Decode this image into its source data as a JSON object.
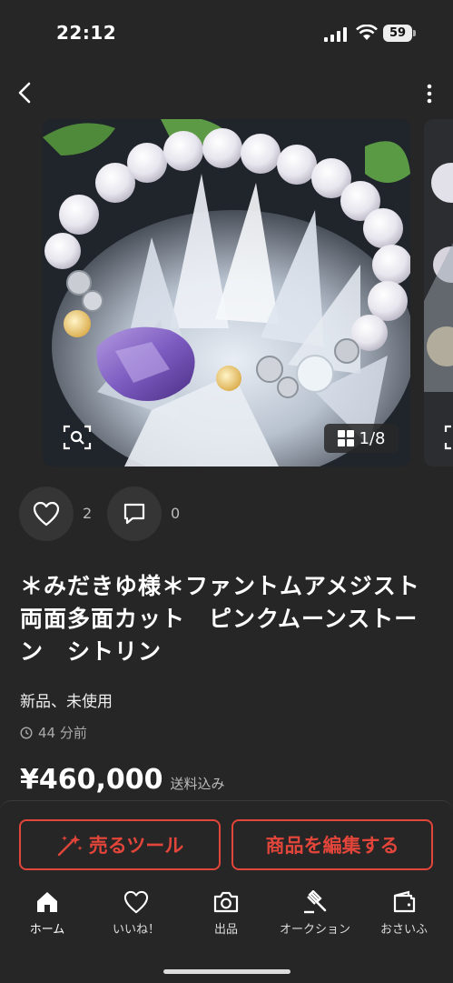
{
  "status_bar": {
    "time": "22:12",
    "battery": "59"
  },
  "gallery": {
    "counter": "1/8"
  },
  "engagement": {
    "likes": "2",
    "comments": "0"
  },
  "item": {
    "title": "＊みだきゆ様＊ファントムアメジスト両面多面カット　ピンクムーンストーン　シトリン",
    "condition": "新品、未使用",
    "posted": "44 分前",
    "price": "¥460,000",
    "shipping": "送料込み"
  },
  "buttons": {
    "sell_tool": "売るツール",
    "edit_item": "商品を編集する"
  },
  "tabs": [
    {
      "label": "ホーム",
      "icon": "home-icon"
    },
    {
      "label": "いいね！",
      "icon": "heart-icon"
    },
    {
      "label": "出品",
      "icon": "camera-icon"
    },
    {
      "label": "オークション",
      "icon": "gavel-icon"
    },
    {
      "label": "おさいふ",
      "icon": "wallet-icon"
    }
  ],
  "colors": {
    "accent": "#e2453a",
    "background": "#262626"
  }
}
